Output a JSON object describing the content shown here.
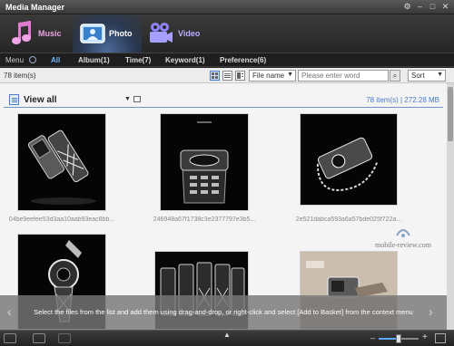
{
  "window": {
    "title": "Media Manager",
    "controls": [
      "settings-icon",
      "minimize-icon",
      "maximize-icon",
      "close-icon"
    ]
  },
  "media_tabs": [
    {
      "label": "Music",
      "icon": "music-note-icon",
      "active": false
    },
    {
      "label": "Photo",
      "icon": "photo-icon",
      "active": true
    },
    {
      "label": "Video",
      "icon": "film-camera-icon",
      "active": false
    }
  ],
  "filters": {
    "menu": "Menu",
    "all": "All",
    "album": "Album(1)",
    "time": "Time(7)",
    "keyword": "Keyword(1)",
    "preference": "Preference(6)"
  },
  "toolbar": {
    "count": "78 item(s)",
    "sort_field": "File name",
    "search_placeholder": "Please enter word",
    "sort_order": "Sort"
  },
  "view": {
    "title": "View all",
    "stats": "78 item(s) | 272.28 MB"
  },
  "thumbnails": [
    {
      "caption": "04be9eefee53d3aa10aab93eac8bb...",
      "kind": "open-flip-phone"
    },
    {
      "caption": "246948a67f1738c3e2377797e3b5...",
      "kind": "closed-slider-phone"
    },
    {
      "caption": "2e521dabca593a6a57bde025f722a...",
      "kind": "phone-with-chain"
    },
    {
      "caption": "",
      "kind": "round-phone"
    },
    {
      "caption": "",
      "kind": "phone-row"
    },
    {
      "caption": "",
      "kind": "phone-on-desk"
    }
  ],
  "watermark": "mobile-review.com",
  "overlay_message": "Select the files from the list and add them using drag-and-drop, or right-click and select [Add to Basket] from the context menu",
  "zoom": {
    "level": 0.5
  },
  "colors": {
    "accent": "#4a7cc7",
    "filter_active": "#6fb8ff",
    "music": "#e8a6e0",
    "video": "#b8b0ff"
  }
}
